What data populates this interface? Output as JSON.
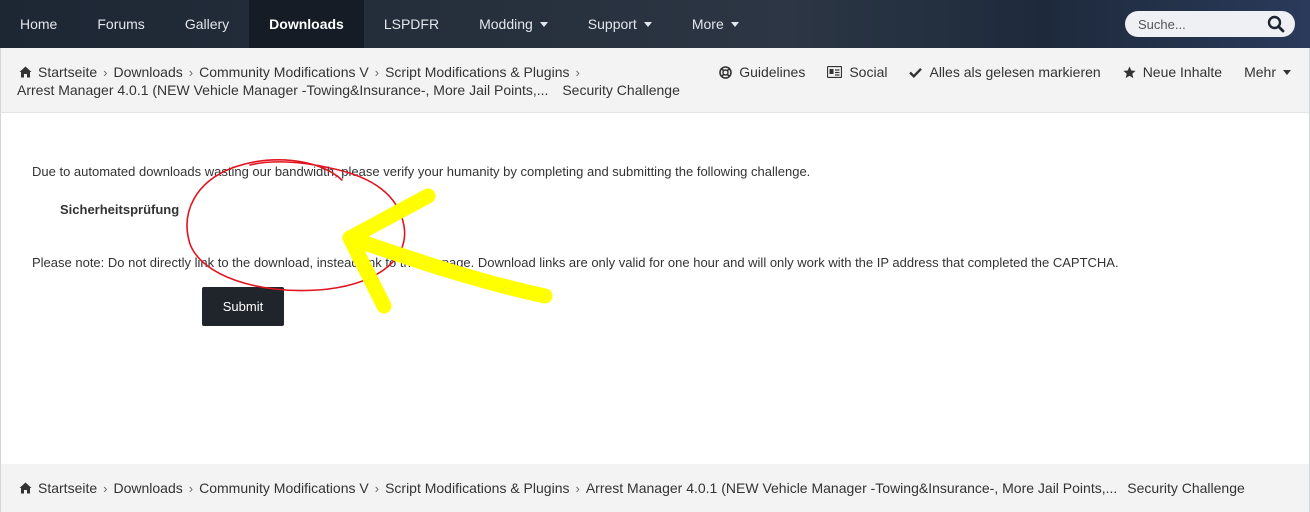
{
  "nav": {
    "items": [
      {
        "label": "Home",
        "active": false,
        "dropdown": false
      },
      {
        "label": "Forums",
        "active": false,
        "dropdown": false
      },
      {
        "label": "Gallery",
        "active": false,
        "dropdown": false
      },
      {
        "label": "Downloads",
        "active": true,
        "dropdown": false
      },
      {
        "label": "LSPDFR",
        "active": false,
        "dropdown": false
      },
      {
        "label": "Modding",
        "active": false,
        "dropdown": true
      },
      {
        "label": "Support",
        "active": false,
        "dropdown": true
      },
      {
        "label": "More",
        "active": false,
        "dropdown": true
      }
    ],
    "search_placeholder": "Suche..."
  },
  "breadcrumb": {
    "items": [
      "Startseite",
      "Downloads",
      "Community Modifications V",
      "Script Modifications & Plugins"
    ],
    "file": "Arrest Manager 4.0.1 (NEW Vehicle Manager -Towing&Insurance-, More Jail Points,...",
    "current": "Security Challenge"
  },
  "header_links": {
    "guidelines": "Guidelines",
    "social": "Social",
    "mark_read": "Alles als gelesen markieren",
    "new_content": "Neue Inhalte",
    "more": "Mehr"
  },
  "content": {
    "intro": "Due to automated downloads wasting our bandwidth, please verify your humanity by completing and submitting the following challenge.",
    "captcha_label": "Sicherheitsprüfung",
    "note": "Please note: Do not directly link to the download, instead link to the file page. Download links are only valid for one hour and will only work with the IP address that completed the CAPTCHA.",
    "submit_label": "Submit"
  },
  "colors": {
    "annotation_circle": "#e0141e",
    "annotation_arrow": "#ffff00",
    "submit_bg": "#20252b"
  }
}
